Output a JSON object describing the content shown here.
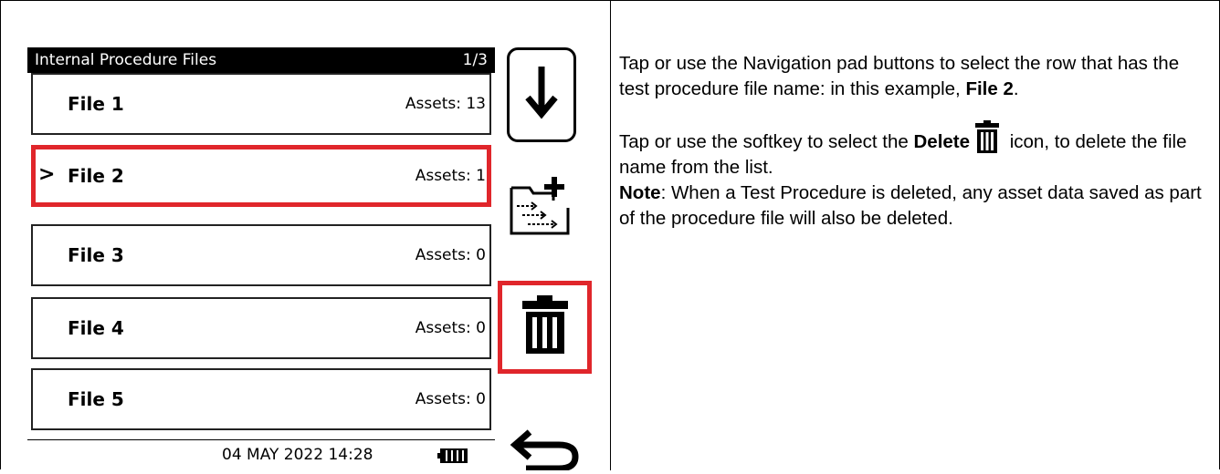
{
  "screen": {
    "title": "Internal Procedure Files",
    "page_indicator": "1/3",
    "rows": [
      {
        "name": "File 1",
        "assets": "Assets: 13",
        "selected": false
      },
      {
        "name": "File 2",
        "assets": "Assets: 1",
        "selected": true
      },
      {
        "name": "File 3",
        "assets": "Assets: 0",
        "selected": false
      },
      {
        "name": "File 4",
        "assets": "Assets: 0",
        "selected": false
      },
      {
        "name": "File 5",
        "assets": "Assets: 0",
        "selected": false
      }
    ],
    "selection_marker": ">",
    "datetime": "04 MAY 2022 14:28"
  },
  "softkeys": [
    {
      "icon": "download-arrow-icon"
    },
    {
      "icon": "new-folder-icon"
    },
    {
      "icon": "trash-icon",
      "highlighted": true
    },
    {
      "icon": "back-arrow-icon"
    }
  ],
  "instructions": {
    "p1_text": "Tap or use the Navigation pad buttons to select the row that has the test procedure file name: in this example, ",
    "p1_bold": "File 2",
    "p1_end": ".",
    "p2_text": "Tap or use the softkey to select the ",
    "p2_bold": "Delete",
    "p2_end": " icon, to delete the file name from the list.",
    "note_label": "Note",
    "note_text": ": When a Test Procedure is deleted, any asset data saved as part of the procedure file will also be deleted."
  },
  "colors": {
    "highlight": "#e0262b",
    "title_bar": "#000000"
  }
}
